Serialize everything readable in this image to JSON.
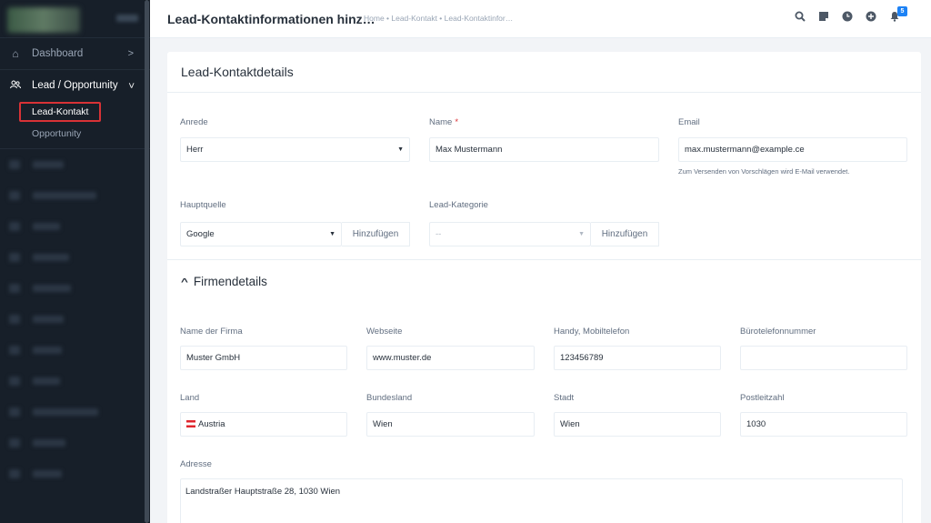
{
  "sidebar": {
    "items": [
      {
        "label": "Dashboard",
        "icon": "home-icon"
      },
      {
        "label": "Lead / Opportunity",
        "icon": "users-icon"
      }
    ],
    "subitems": [
      {
        "label": "Lead-Kontakt"
      },
      {
        "label": "Opportunity"
      }
    ]
  },
  "header": {
    "title": "Lead-Kontaktinformationen hinz…",
    "breadcrumb": "Home • Lead-Kontakt • Lead-Kontaktinfor…",
    "notification_count": "5",
    "icons": [
      "search-icon",
      "sticky-note-icon",
      "clock-icon",
      "plus-circle-icon",
      "bell-icon"
    ]
  },
  "form": {
    "card_title": "Lead-Kontaktdetails",
    "anrede": {
      "label": "Anrede",
      "value": "Herr"
    },
    "name": {
      "label": "Name",
      "required": "*",
      "value": "Max Mustermann"
    },
    "email": {
      "label": "Email",
      "value": "max.mustermann@example.ce",
      "hint": "Zum Versenden von Vorschlägen wird E-Mail verwendet."
    },
    "hauptquelle": {
      "label": "Hauptquelle",
      "value": "Google",
      "add_label": "Hinzufügen"
    },
    "kategorie": {
      "label": "Lead-Kategorie",
      "value": "--",
      "add_label": "Hinzufügen"
    },
    "company_section_title": "Firmendetails",
    "firma": {
      "label": "Name der Firma",
      "value": "Muster GmbH"
    },
    "webseite": {
      "label": "Webseite",
      "value": "www.muster.de"
    },
    "handy": {
      "label": "Handy, Mobiltelefon",
      "value": "123456789"
    },
    "buero": {
      "label": "Bürotelefonnummer",
      "value": ""
    },
    "land": {
      "label": "Land",
      "value": "Austria"
    },
    "bundesland": {
      "label": "Bundesland",
      "value": "Wien"
    },
    "stadt": {
      "label": "Stadt",
      "value": "Wien"
    },
    "plz": {
      "label": "Postleitzahl",
      "value": "1030"
    },
    "adresse": {
      "label": "Adresse",
      "value": "Landstraßer Hauptstraße 28, 1030 Wien"
    }
  }
}
